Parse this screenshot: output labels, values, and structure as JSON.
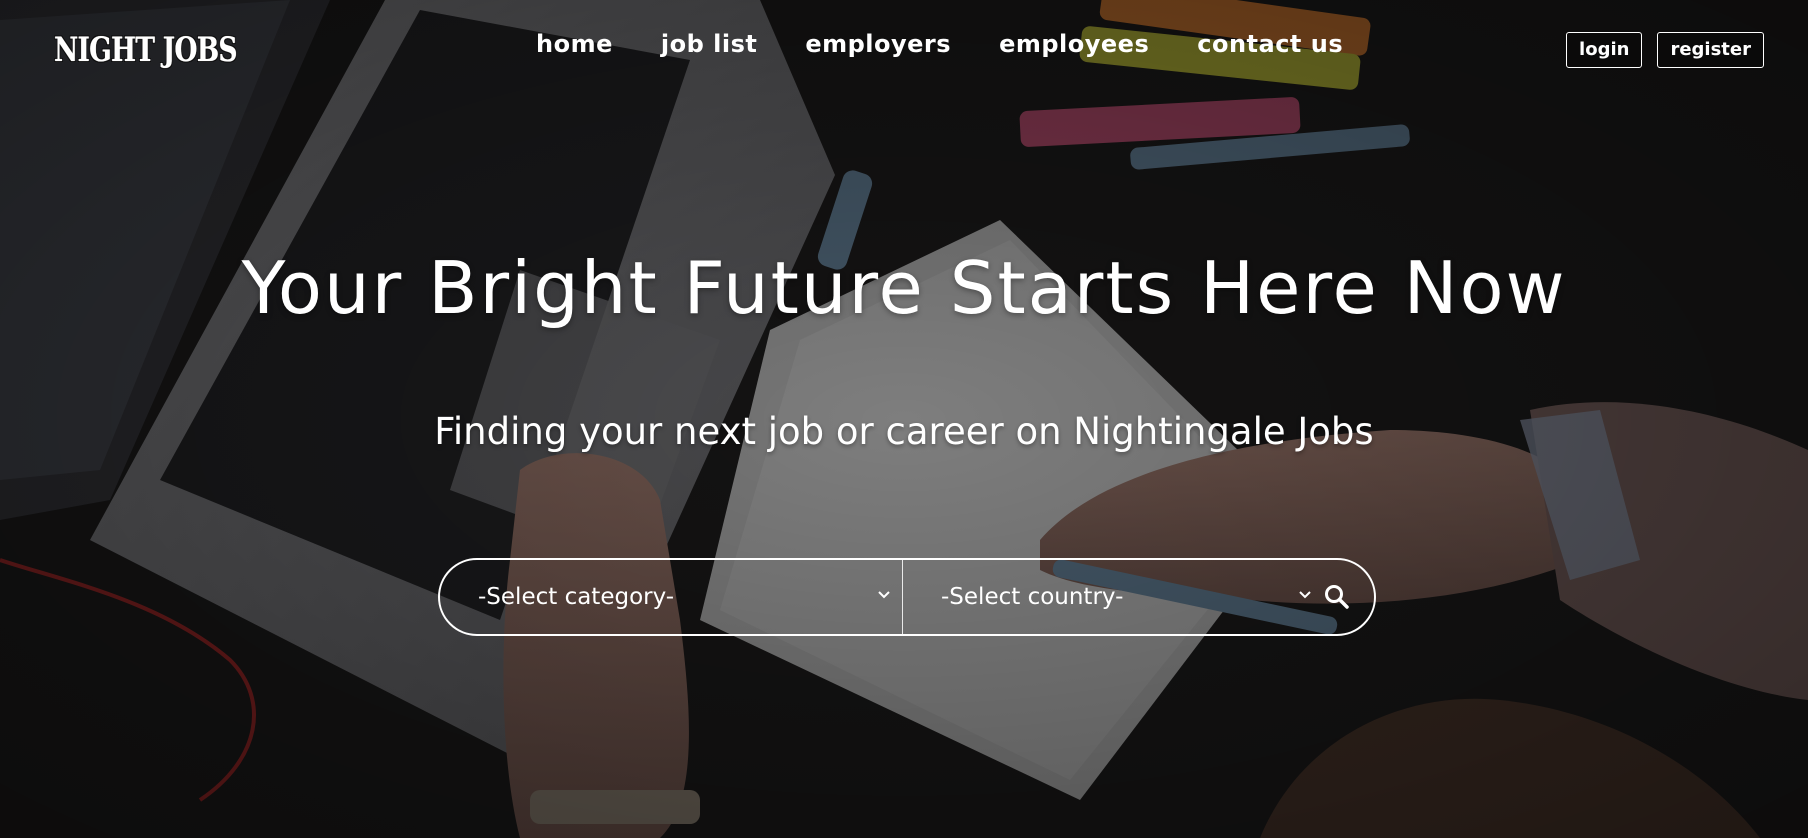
{
  "header": {
    "logo": "NIGHT JOBS",
    "nav": [
      {
        "label": "home"
      },
      {
        "label": "job list"
      },
      {
        "label": "employers"
      },
      {
        "label": "employees"
      },
      {
        "label": "contact us"
      }
    ],
    "login_label": "login",
    "register_label": "register"
  },
  "hero": {
    "headline": "Your Bright Future Starts Here Now",
    "subheadline": "Finding your next job or career on Nightingale Jobs"
  },
  "search": {
    "category_value": "-Select category-",
    "country_value": "-Select country-",
    "icons": [
      "chevron-down-icon",
      "chevron-down-icon",
      "search-icon"
    ]
  },
  "colors": {
    "text": "#ffffff",
    "background": "#151515"
  }
}
